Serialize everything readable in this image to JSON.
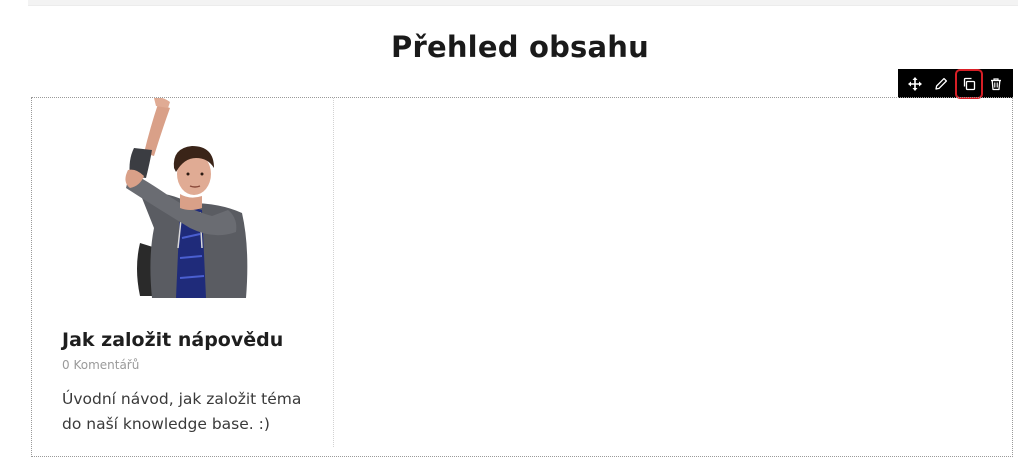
{
  "page": {
    "title": "Přehled obsahu"
  },
  "toolbar": {
    "buttons": [
      {
        "icon": "move-icon"
      },
      {
        "icon": "pencil-icon"
      },
      {
        "icon": "duplicate-icon",
        "highlighted": true
      },
      {
        "icon": "trash-icon"
      }
    ]
  },
  "post": {
    "title": "Jak založit nápovědu",
    "comments": "0 Komentářů",
    "excerpt": "Úvodní návod, jak založit téma do naší knowledge base. :)"
  },
  "colors": {
    "toolbar_bg": "#000000",
    "highlight": "#d81f26",
    "title": "#1a1a1a",
    "meta": "#9a9a9a"
  }
}
